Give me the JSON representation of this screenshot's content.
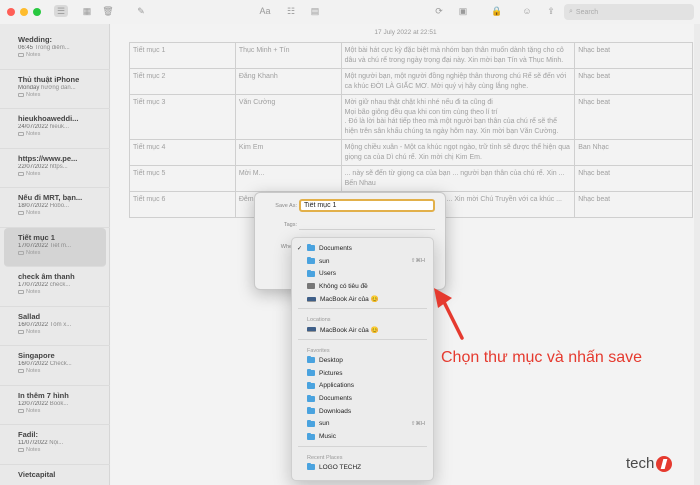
{
  "toolbar": {
    "icons": [
      "sidebar-list-icon",
      "grid-icon",
      "trash-icon",
      "compose-icon",
      "font-icon",
      "checklist-icon",
      "table-icon",
      "share-photo-icon",
      "media-icon",
      "lock-icon",
      "collab-icon",
      "export-icon"
    ],
    "font_label": "Aa",
    "search_placeholder": "Search"
  },
  "notes": [
    {
      "title": "Wedding:",
      "time": "06:45",
      "preview": "Trong điểm...",
      "folder": "Notes",
      "selected": false
    },
    {
      "title": "Thủ thuật iPhone",
      "time": "Monday",
      "preview": "hướng dẫn...",
      "folder": "Notes",
      "selected": false
    },
    {
      "title": "hieukhoaweddi...",
      "time": "24/07/2022",
      "preview": "hieuk...",
      "folder": "Notes",
      "selected": false
    },
    {
      "title": "https://www.pe...",
      "time": "22/07/2022",
      "preview": "https...",
      "folder": "Notes",
      "selected": false
    },
    {
      "title": "Nếu đi MRT, bạn...",
      "time": "18/07/2022",
      "preview": "Hobo...",
      "folder": "Notes",
      "selected": false
    },
    {
      "title": "Tiết mục 1",
      "time": "17/07/2022",
      "preview": "Tiết m...",
      "folder": "Notes",
      "selected": true
    },
    {
      "title": "check âm thanh",
      "time": "17/07/2022",
      "preview": "check...",
      "folder": "Notes",
      "selected": false
    },
    {
      "title": "Sallad",
      "time": "16/07/2022",
      "preview": "Tôm x...",
      "folder": "Notes",
      "selected": false
    },
    {
      "title": "Singapore",
      "time": "16/07/2022",
      "preview": "Check...",
      "folder": "Notes",
      "selected": false
    },
    {
      "title": "In thêm 7 hình",
      "time": "12/07/2022",
      "preview": "Book...",
      "folder": "Notes",
      "selected": false
    },
    {
      "title": "Fadil:",
      "time": "11/07/2022",
      "preview": "Nội...",
      "folder": "Notes",
      "selected": false
    },
    {
      "title": "Vietcapital",
      "time": "",
      "preview": "",
      "folder": "",
      "selected": false
    }
  ],
  "note_date": "17 July 2022 at 22:51",
  "table": [
    [
      "Tiết mục 1",
      "Thục Minh + Tín",
      "Một bài hát cực kỳ đặc biệt mà nhóm bạn thân muốn dành tặng cho cô dâu và chú rể trong ngày trọng đại này. Xin mời bạn Tín và Thục Minh.",
      "Nhạc beat"
    ],
    [
      "Tiết mục 2",
      "Đăng Khanh",
      "Một người bạn, một người đồng nghiệp thân thương chú Rể sẽ đến với ca khúc ĐỜI LÀ GIẤC MƠ. Mời quý vị hãy cùng lắng nghe.",
      "Nhạc beat"
    ],
    [
      "Tiết mục 3",
      "Văn Cường",
      "Mời giữ nhau thật chặt khi nhé nếu đi ta cũng đi\nMọi bão giông đều qua khi con tim cùng theo lí trí\n. Đó là lời bài hát tiếp theo mà một người bạn thân của chú rể sẽ thể hiện trên sân khấu chúng ta ngày hôm nay. Xin mời bạn Văn Cường.",
      "Nhạc beat"
    ],
    [
      "Tiết mục 4",
      "Kim Em",
      "Mộng chiều xuân - Một ca khúc ngọt ngào, trữ tình sẽ được thể hiện qua giọng ca của Dì chú rể. Xin mời chị Kim Em.",
      "Ban Nhạc"
    ],
    [
      "Tiết mục 5",
      "Mời M...",
      "... này sẽ đến từ giọng ca của bạn ... người bạn thân của chú rể. Xin ... Bến Nhau",
      "Nhạc beat"
    ],
    [
      "Tiết mục 6",
      "Đêm ... Từ Th...",
      "... hát hàng nghìn cây số để đến ... Xin mời Chú Truyền với ca khúc ... Từ Thiên.",
      "Nhạc beat"
    ]
  ],
  "dialog": {
    "save_as_label": "Save As:",
    "save_as_value": "Tiết mục 1",
    "tags_label": "Tags:",
    "where_label": "Where"
  },
  "dropdown": {
    "top_items": [
      {
        "label": "Documents",
        "icon": "folder-icon",
        "checked": true,
        "shortcut": ""
      },
      {
        "label": "sun",
        "icon": "folder-icon",
        "checked": false,
        "shortcut": "⇧⌘H"
      },
      {
        "label": "Users",
        "icon": "folder-icon",
        "checked": false,
        "shortcut": ""
      },
      {
        "label": "Không có tiêu đề",
        "icon": "disk-icon",
        "checked": false,
        "shortcut": ""
      },
      {
        "label": "MacBook Air của 😊",
        "icon": "macbook-icon",
        "checked": false,
        "shortcut": ""
      }
    ],
    "locations_label": "Locations",
    "locations": [
      {
        "label": "MacBook Air của 😊",
        "icon": "macbook-icon"
      }
    ],
    "favorites_label": "Favorites",
    "favorites": [
      {
        "label": "Desktop",
        "icon": "folder-icon",
        "shortcut": ""
      },
      {
        "label": "Pictures",
        "icon": "folder-icon",
        "shortcut": ""
      },
      {
        "label": "Applications",
        "icon": "folder-icon",
        "shortcut": ""
      },
      {
        "label": "Documents",
        "icon": "folder-icon",
        "shortcut": ""
      },
      {
        "label": "Downloads",
        "icon": "folder-icon",
        "shortcut": ""
      },
      {
        "label": "sun",
        "icon": "folder-icon",
        "shortcut": "⇧⌘H"
      },
      {
        "label": "Music",
        "icon": "folder-icon",
        "shortcut": ""
      }
    ],
    "recent_label": "Recent Places",
    "recent": [
      {
        "label": "LOGO TECHZ",
        "icon": "folder-icon"
      }
    ]
  },
  "annotation_text": "Chọn thư mục và nhấn save",
  "logo_text": "tech",
  "colors": {
    "accent_red": "#e53a2f",
    "folder_blue": "#4aa3df",
    "focus_ring": "#e2b04a"
  }
}
